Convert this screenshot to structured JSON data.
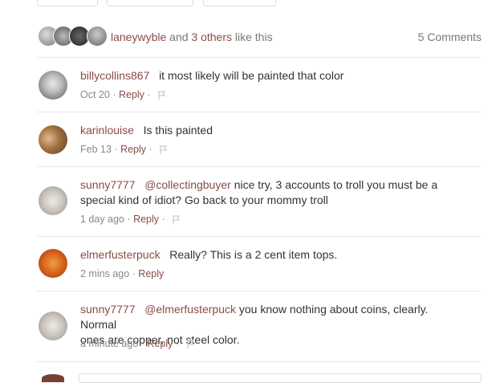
{
  "likes": {
    "first_user": "laneywyble",
    "and_text": "and",
    "others_link": "3 others",
    "like_text": "like this",
    "comments_count": "5 Comments"
  },
  "comments": [
    {
      "user": "billycollins867",
      "mention": "",
      "text": "it most likely will be painted that color",
      "text2": "",
      "date": "Oct 20",
      "reply": "Reply",
      "flag": true
    },
    {
      "user": "karinlouise",
      "mention": "",
      "text": "Is this painted",
      "text2": "",
      "date": "Feb 13",
      "reply": "Reply",
      "flag": true
    },
    {
      "user": "sunny7777",
      "mention": "@collectingbuyer",
      "text": "nice try, 3 accounts to troll you must be a",
      "text2": "special kind of idiot? Go back to your mommy troll",
      "date": "1 day ago",
      "reply": "Reply",
      "flag": true
    },
    {
      "user": "elmerfusterpuck",
      "mention": "",
      "text": "Really? This is a 2 cent item tops.",
      "text2": "",
      "date": "2 mins ago",
      "reply": "Reply",
      "flag": false
    },
    {
      "user": "sunny7777",
      "mention": "@elmerfusterpuck",
      "text": "you know nothing about coins, clearly. Normal",
      "text2": "ones are copper, not steel color.",
      "date": "a minute ago",
      "reply": "Reply",
      "flag": true
    }
  ],
  "separator": "·",
  "colors": {
    "link": "#8a4c46",
    "meta": "#888888",
    "divider": "#e9e9e9"
  }
}
